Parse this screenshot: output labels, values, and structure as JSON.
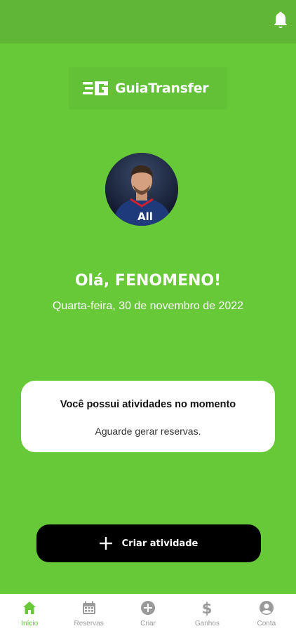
{
  "colors": {
    "primary": "#67c938",
    "topbar": "#5fb735",
    "inactive": "#9a9a9a"
  },
  "header": {
    "notification_icon": "bell-icon"
  },
  "logo": {
    "part1": "Guia",
    "part2": "Transfer"
  },
  "profile": {
    "avatar_icon": "user-photo"
  },
  "greeting": {
    "text": "Olá,  FENOMENO!"
  },
  "date": {
    "text": "Quarta-feira, 30 de novembro de 2022"
  },
  "activity_card": {
    "title": "Você possui atividades no momento",
    "subtitle": "Aguarde gerar reservas."
  },
  "cta": {
    "label": "Criar atividade",
    "icon": "plus-icon"
  },
  "tabbar": {
    "items": [
      {
        "label": "Início",
        "icon": "home-icon",
        "active": true
      },
      {
        "label": "Reservas",
        "icon": "calendar-icon",
        "active": false
      },
      {
        "label": "Criar",
        "icon": "plus-circle-icon",
        "active": false
      },
      {
        "label": "Ganhos",
        "icon": "dollar-icon",
        "active": false
      },
      {
        "label": "Conta",
        "icon": "account-icon",
        "active": false
      }
    ]
  }
}
